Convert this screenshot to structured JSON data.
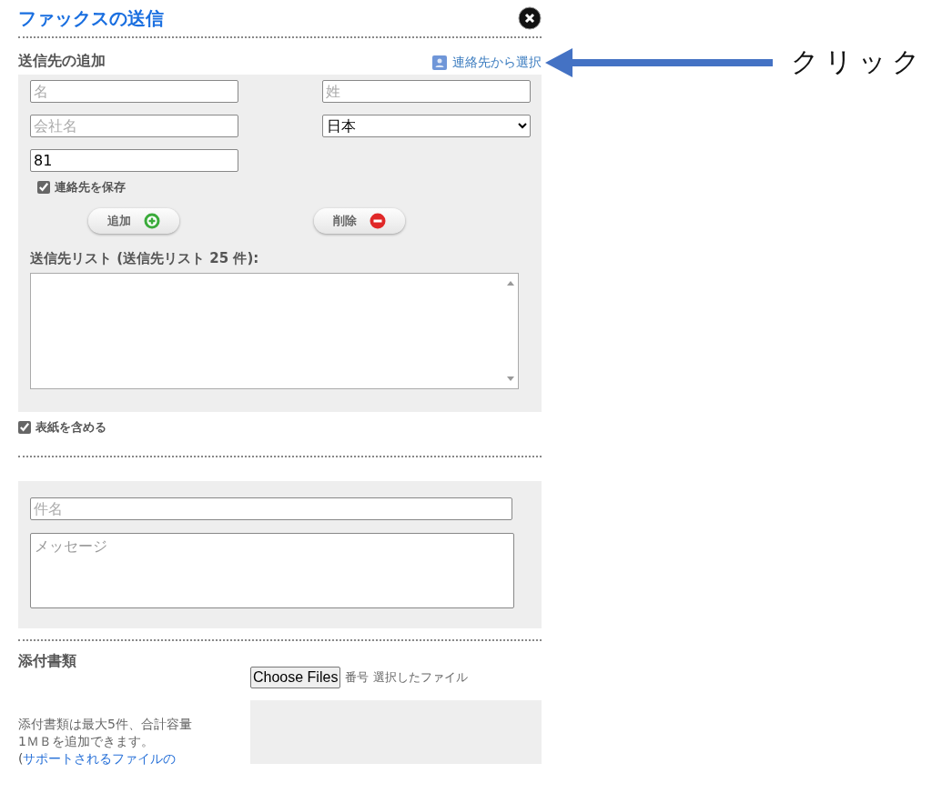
{
  "dialog": {
    "title": "ファックスの送信"
  },
  "recipients": {
    "heading": "送信先の追加",
    "contacts_link": "連絡先から選択",
    "first_name": {
      "placeholder": "名"
    },
    "last_name": {
      "placeholder": "姓"
    },
    "company": {
      "placeholder": "会社名"
    },
    "country": {
      "value": "日本"
    },
    "fax_number": {
      "value": "81"
    },
    "save_contact": {
      "label": "連絡先を保存",
      "checked": true
    },
    "buttons": [
      {
        "label": "追加",
        "kind": "add"
      },
      {
        "label": "削除",
        "kind": "remove"
      }
    ],
    "list_label": "送信先リスト (送信先リスト 25 件):"
  },
  "cover_page": {
    "label": "表紙を含める",
    "checked": true
  },
  "message": {
    "subject": {
      "placeholder": "件名"
    },
    "body": {
      "placeholder": "メッセージ"
    }
  },
  "attachments": {
    "heading": "添付書類",
    "choose_button": "Choose Files",
    "column_labels": [
      "番号",
      "選択したファイル"
    ],
    "note": "添付書類は最大5件、合計容量1ＭＢを追加できます。",
    "link_prefix": "(",
    "link": "サポートされるファイルの"
  },
  "annotation": {
    "label": "クリック"
  }
}
